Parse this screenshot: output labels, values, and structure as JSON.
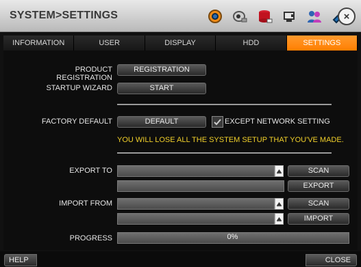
{
  "titlebar": {
    "title": "SYSTEM>SETTINGS",
    "icons": [
      "settings-gear-icon",
      "camera-icon",
      "storage-icon",
      "network-icon",
      "user-icon",
      "usb-icon"
    ]
  },
  "tabs": [
    {
      "label": "INFORMATION",
      "active": false
    },
    {
      "label": "USER",
      "active": false
    },
    {
      "label": "DISPLAY",
      "active": false
    },
    {
      "label": "HDD",
      "active": false
    },
    {
      "label": "SETTINGS",
      "active": true
    }
  ],
  "settings": {
    "product_registration_label": "PRODUCT REGISTRATION",
    "registration_button": "REGISTRATION",
    "startup_wizard_label": "STARTUP WIZARD",
    "start_button": "START",
    "factory_default_label": "FACTORY DEFAULT",
    "default_button": "DEFAULT",
    "except_network_label": "EXCEPT NETWORK SETTING",
    "warning": "YOU WILL LOSE ALL THE SYSTEM SETUP THAT YOU'VE MADE.",
    "export_to_label": "EXPORT TO",
    "scan_button": "SCAN",
    "export_button": "EXPORT",
    "import_from_label": "IMPORT FROM",
    "scan_button_2": "SCAN",
    "import_button": "IMPORT",
    "progress_label": "PROGRESS",
    "progress_value": "0%",
    "export_to_value": "",
    "export_path_value": "",
    "import_from_value": "",
    "import_path_value": "",
    "except_network_checked": true
  },
  "footer": {
    "help": "HELP",
    "close": "CLOSE"
  }
}
